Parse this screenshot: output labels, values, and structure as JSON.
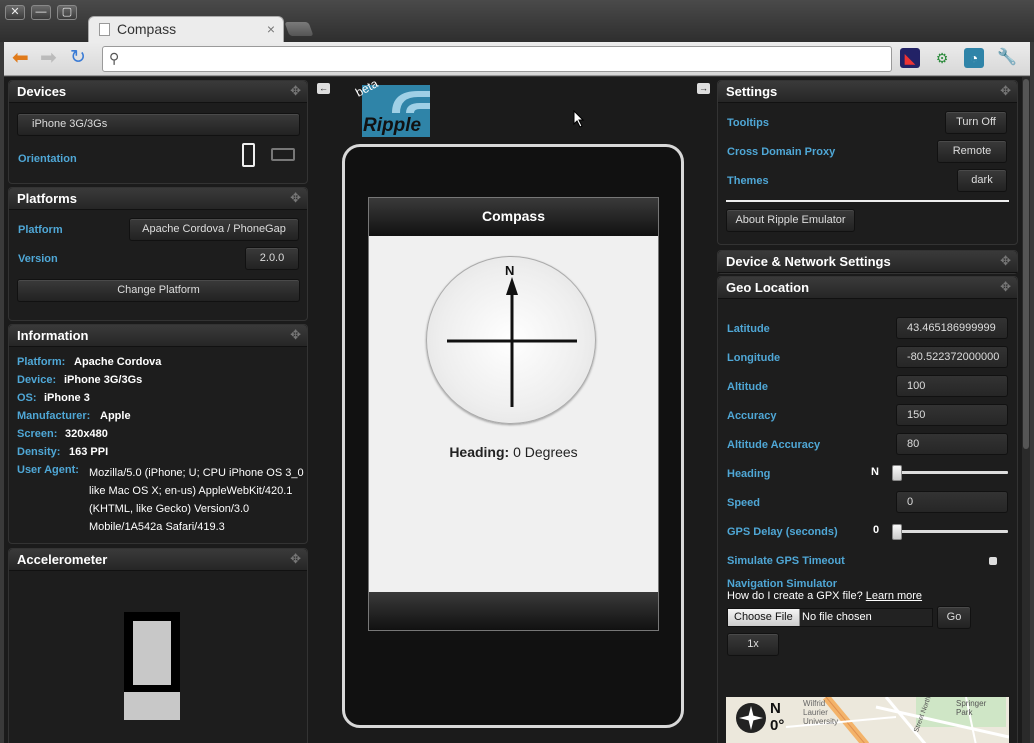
{
  "browser": {
    "tab_title": "Compass",
    "tab_close": "×",
    "url": "",
    "window_buttons": [
      "✕",
      "—",
      "▢"
    ]
  },
  "devices": {
    "title": "Devices",
    "device": "iPhone 3G/3Gs",
    "orientation_label": "Orientation"
  },
  "platforms": {
    "title": "Platforms",
    "platform_label": "Platform",
    "platform_value": "Apache Cordova / PhoneGap",
    "version_label": "Version",
    "version_value": "2.0.0",
    "change_button": "Change Platform"
  },
  "information": {
    "title": "Information",
    "rows": [
      {
        "key": "Platform:",
        "value": "Apache Cordova"
      },
      {
        "key": "Device:",
        "value": "iPhone 3G/3Gs"
      },
      {
        "key": "OS:",
        "value": "iPhone 3"
      },
      {
        "key": "Manufacturer:",
        "value": "Apple"
      },
      {
        "key": "Screen:",
        "value": "320x480"
      },
      {
        "key": "Density:",
        "value": "163 PPI"
      }
    ],
    "ua_key": "User Agent:",
    "ua_lines": [
      "Mozilla/5.0 (iPhone; U; CPU iPhone OS 3_0",
      "like Mac OS X; en-us) AppleWebKit/420.1",
      "(KHTML, like Gecko) Version/3.0",
      "Mobile/1A542a Safari/419.3"
    ]
  },
  "accelerometer": {
    "title": "Accelerometer"
  },
  "logo": {
    "beta": "beta",
    "name": "Ripple"
  },
  "phone": {
    "header": "Compass",
    "compass_letter": "N",
    "heading_label": "Heading:",
    "heading_value": "0 Degrees"
  },
  "settings": {
    "title": "Settings",
    "tooltips_label": "Tooltips",
    "tooltips_button": "Turn Off",
    "proxy_label": "Cross Domain Proxy",
    "proxy_button": "Remote",
    "themes_label": "Themes",
    "themes_button": "dark",
    "about_button": "About Ripple Emulator"
  },
  "network": {
    "title": "Device & Network Settings"
  },
  "geo": {
    "title": "Geo Location",
    "latitude_label": "Latitude",
    "latitude": "43.465186999999",
    "longitude_label": "Longitude",
    "longitude": "-80.522372000000",
    "altitude_label": "Altitude",
    "altitude": "100",
    "accuracy_label": "Accuracy",
    "accuracy": "150",
    "alt_accuracy_label": "Altitude Accuracy",
    "alt_accuracy": "80",
    "heading_label": "Heading",
    "heading_value": "N",
    "heading_fraction": 0,
    "speed_label": "Speed",
    "speed": "0",
    "gps_delay_label": "GPS Delay (seconds)",
    "gps_delay": "0",
    "gps_delay_fraction": 0,
    "timeout_label": "Simulate GPS Timeout",
    "nav_label": "Navigation Simulator",
    "gpx_question": "How do I create a GPX file?",
    "learn_more": "Learn more",
    "choose_file": "Choose File",
    "no_file": "No file chosen",
    "go": "Go",
    "speed_multiplier": "1x",
    "map_dir": "N",
    "map_deg": "0°",
    "map_labels": [
      "Wilfrid",
      "Laurier",
      "University",
      "Springer",
      "Park",
      "Street North"
    ]
  },
  "colors": {
    "accent": "#4fa7d6",
    "panel_bg": "#1d1d1d",
    "ripple_blue": "#2f84a8"
  }
}
